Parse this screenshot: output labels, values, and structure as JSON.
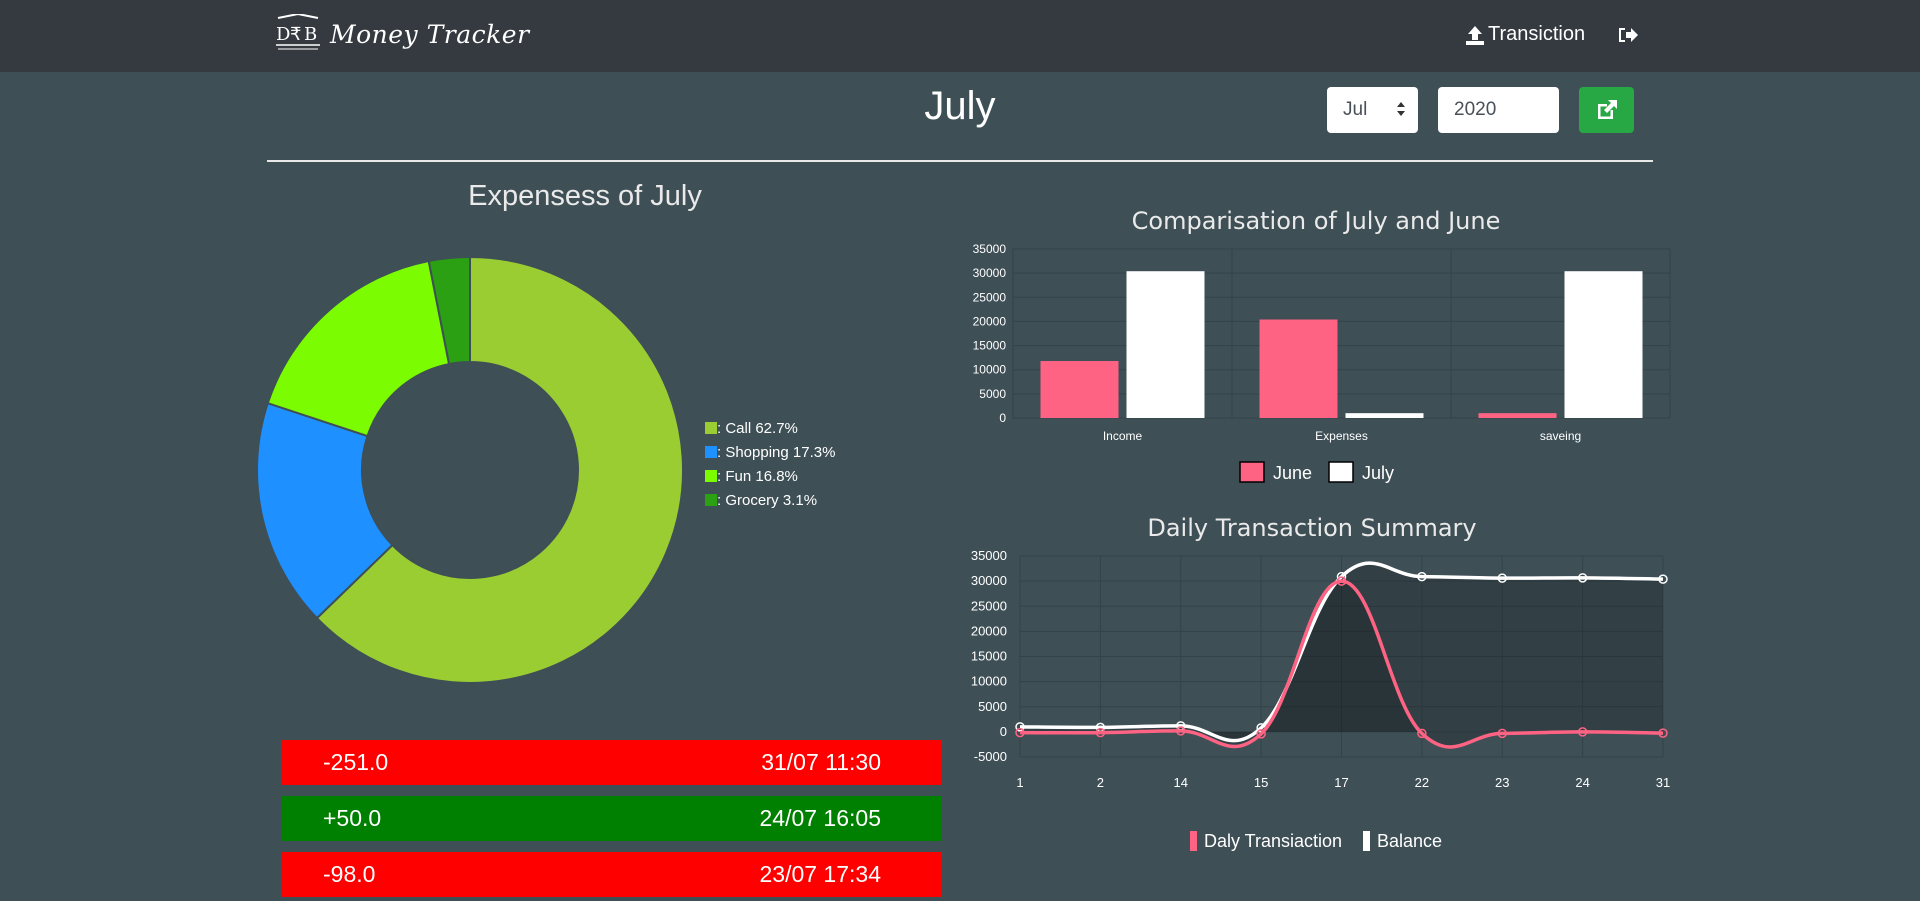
{
  "nav": {
    "brand": "Money Tracker",
    "transaction_label": "Transiction",
    "logout_icon": "sign-out-icon"
  },
  "controls": {
    "month_title": "July",
    "month_value": "Jul",
    "year_value": "2020",
    "go_icon": "external-link-icon"
  },
  "donut": {
    "title": "Expensess of July"
  },
  "transactions": [
    {
      "amount": "-251.0",
      "datetime": "31/07 11:30",
      "kind": "negative"
    },
    {
      "amount": "+50.0",
      "datetime": "24/07 16:05",
      "kind": "positive"
    },
    {
      "amount": "-98.0",
      "datetime": "23/07 17:34",
      "kind": "negative"
    }
  ],
  "chart_data": [
    {
      "type": "pie",
      "variant": "doughnut",
      "title": "Expensess of July",
      "categories": [
        "Call",
        "Shopping",
        "Fun",
        "Grocery"
      ],
      "values": [
        62.7,
        17.3,
        16.8,
        3.1
      ],
      "legend_labels": [
        ": Call 62.7%",
        ": Shopping 17.3%",
        ": Fun 16.8%",
        ": Grocery 3.1%"
      ],
      "colors": [
        "#9acd32",
        "#1e90ff",
        "#7cfc00",
        "#2aa012"
      ],
      "legend_position": "right"
    },
    {
      "type": "bar",
      "title": "Comparisation of July and June",
      "categories": [
        "Income",
        "Expenses",
        "saveing"
      ],
      "series": [
        {
          "name": "June",
          "values": [
            11800,
            20400,
            1000
          ],
          "color": "#ff6384"
        },
        {
          "name": "July",
          "values": [
            30400,
            1000,
            30400
          ],
          "color": "#ffffff"
        }
      ],
      "ylim": [
        0,
        35000
      ],
      "yticks": [
        "35000",
        "30000",
        "25000",
        "20000",
        "15000",
        "10000",
        "5000",
        "0"
      ],
      "grid": true,
      "legend_position": "bottom"
    },
    {
      "type": "line",
      "title": "Daily Transaction Summary",
      "x": [
        "1",
        "2",
        "14",
        "15",
        "17",
        "22",
        "23",
        "24",
        "31"
      ],
      "series": [
        {
          "name": "Daly Transiaction",
          "values": [
            -150,
            -150,
            200,
            -400,
            30000,
            -300,
            -300,
            0,
            -251
          ],
          "color": "#ff6384"
        },
        {
          "name": "Balance",
          "values": [
            1000,
            900,
            1200,
            800,
            30900,
            30900,
            30600,
            30650,
            30400
          ],
          "color": "#ffffff"
        }
      ],
      "ylim": [
        -5000,
        35000
      ],
      "yticks": [
        "35000",
        "30000",
        "25000",
        "20000",
        "15000",
        "10000",
        "5000",
        "0",
        "-5000"
      ],
      "grid": true,
      "legend_position": "bottom"
    }
  ]
}
